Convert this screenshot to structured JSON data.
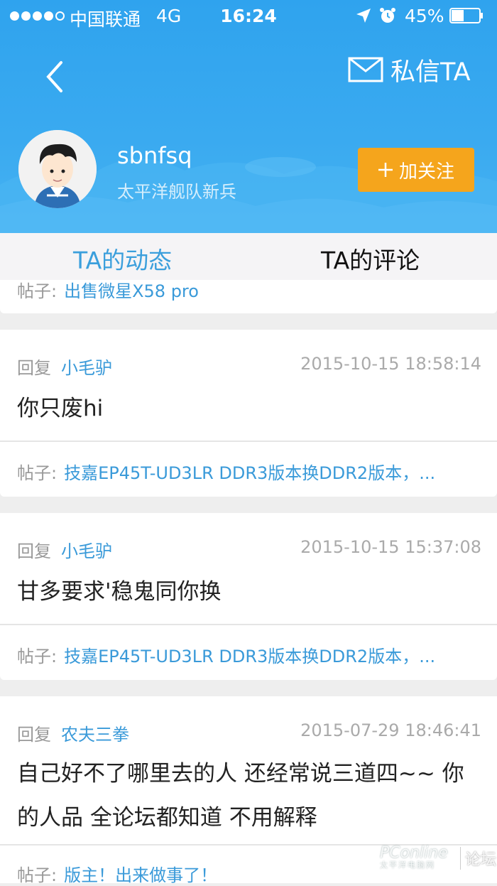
{
  "status_bar": {
    "carrier": "中国联通",
    "network": "4G",
    "time": "16:24",
    "battery": "45%",
    "battery_level": 0.45,
    "signal_bars": 4
  },
  "header": {
    "message_label": "私信TA",
    "username": "sbnfsq",
    "rank": "太平洋舰队新兵",
    "follow_label": "加关注"
  },
  "tabs": [
    {
      "label": "TA的动态",
      "active": true
    },
    {
      "label": "TA的评论",
      "active": false
    }
  ],
  "partial_post": {
    "label": "帖子:",
    "title": "出售微星X58 pro"
  },
  "comments": [
    {
      "reply_label": "回复",
      "reply_to": "小毛驴",
      "time": "2015-10-15 18:58:14",
      "content": "你只废hi",
      "post_label": "帖子:",
      "post_title": "技嘉EP45T-UD3LR DDR3版本换DDR2版本，..."
    },
    {
      "reply_label": "回复",
      "reply_to": "小毛驴",
      "time": "2015-10-15 15:37:08",
      "content": "甘多要求'稳鬼同你换",
      "post_label": "帖子:",
      "post_title": "技嘉EP45T-UD3LR DDR3版本换DDR2版本，..."
    },
    {
      "reply_label": "回复",
      "reply_to": "农夫三拳",
      "time": "2015-07-29 18:46:41",
      "content": "自己好不了哪里去的人 还经常说三道四~~ 你的人品 全论坛都知道 不用解释",
      "post_label": "帖子:",
      "post_title": "版主！出来做事了！"
    }
  ],
  "watermark": {
    "brand": "PConline",
    "sub": "太平洋电脑网",
    "forum": "论坛"
  },
  "colors": {
    "header_blue": "#3aaaf0",
    "follow_orange": "#f5a51c",
    "link_blue": "#3a9ad9"
  }
}
